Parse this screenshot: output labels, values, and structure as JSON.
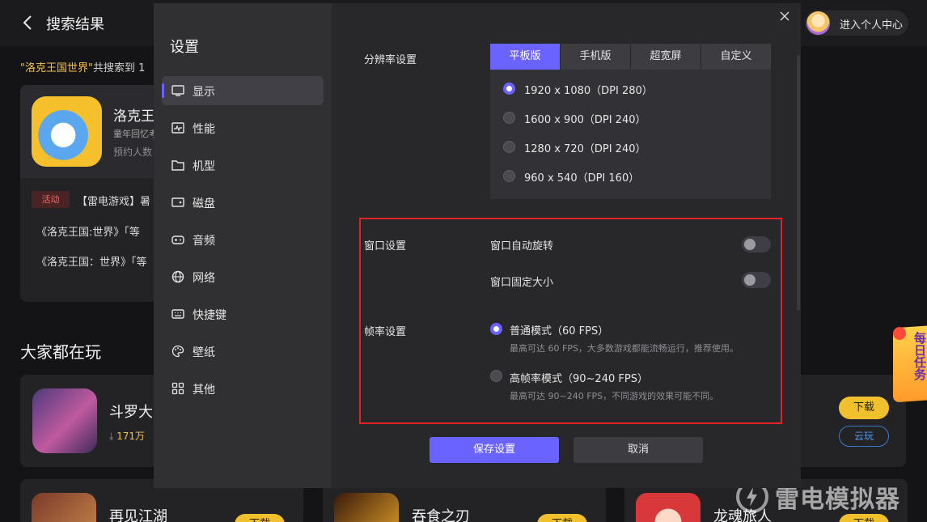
{
  "header": {
    "title": "搜索结果",
    "user_center": "进入个人中心"
  },
  "search_summary": {
    "query_quoted": "\"洛克王国世界\"",
    "suffix": "共搜索到 1"
  },
  "result_card": {
    "name": "洛克王",
    "sub": "童年回忆考",
    "sub2": "预约人数",
    "tag": "活动",
    "news": "【雷电游戏】暑",
    "news2": "《洛克王国:世界》「等",
    "news3": "《洛克王国：世界》「等"
  },
  "popular": {
    "title": "大家都在玩",
    "card": {
      "name": "斗罗大",
      "count": "171万"
    },
    "bottom_cards": [
      {
        "name": "再见江湖",
        "btn": "下载"
      },
      {
        "name": "吞食之刃",
        "btn": "下载"
      },
      {
        "name": "龙魂旅人",
        "btn": "下载"
      }
    ],
    "right_card": {
      "download": "下载",
      "cloud": "云玩"
    }
  },
  "daily_task": "每日任务",
  "watermark": "雷电模拟器",
  "settings": {
    "title": "设置",
    "nav": [
      {
        "label": "显示",
        "icon": "monitor-icon",
        "active": true
      },
      {
        "label": "性能",
        "icon": "performance-icon",
        "active": false
      },
      {
        "label": "机型",
        "icon": "folder-icon",
        "active": false
      },
      {
        "label": "磁盘",
        "icon": "disk-icon",
        "active": false
      },
      {
        "label": "音频",
        "icon": "gamepad-icon",
        "active": false
      },
      {
        "label": "网络",
        "icon": "globe-icon",
        "active": false
      },
      {
        "label": "快捷键",
        "icon": "keyboard-icon",
        "active": false
      },
      {
        "label": "壁纸",
        "icon": "palette-icon",
        "active": false
      },
      {
        "label": "其他",
        "icon": "grid-icon",
        "active": false
      }
    ],
    "resolution": {
      "label": "分辨率设置",
      "tabs": [
        "平板版",
        "手机版",
        "超宽屏",
        "自定义"
      ],
      "active_tab": "平板版",
      "options": [
        {
          "label": "1920 x 1080（DPI 280）",
          "selected": true
        },
        {
          "label": "1600 x 900（DPI 240）",
          "selected": false
        },
        {
          "label": "1280 x 720（DPI 240）",
          "selected": false
        },
        {
          "label": "960 x 540（DPI 160）",
          "selected": false
        }
      ]
    },
    "window": {
      "label": "窗口设置",
      "auto_rotate": {
        "label": "窗口自动旋转",
        "on": false
      },
      "fixed_size": {
        "label": "窗口固定大小",
        "on": false
      }
    },
    "framerate": {
      "label": "帧率设置",
      "modes": [
        {
          "label": "普通模式（60 FPS）",
          "desc": "最高可达 60 FPS，大多数游戏都能流畅运行，推荐使用。",
          "selected": true
        },
        {
          "label": "高帧率模式（90~240 FPS）",
          "desc": "最高可达 90~240 FPS，不同游戏的效果可能不同。",
          "selected": false
        }
      ]
    },
    "buttons": {
      "save": "保存设置",
      "cancel": "取消"
    }
  },
  "colors": {
    "accent": "#6b63ff",
    "highlight_border": "#e2242a",
    "download_yellow": "#f0c12c"
  }
}
